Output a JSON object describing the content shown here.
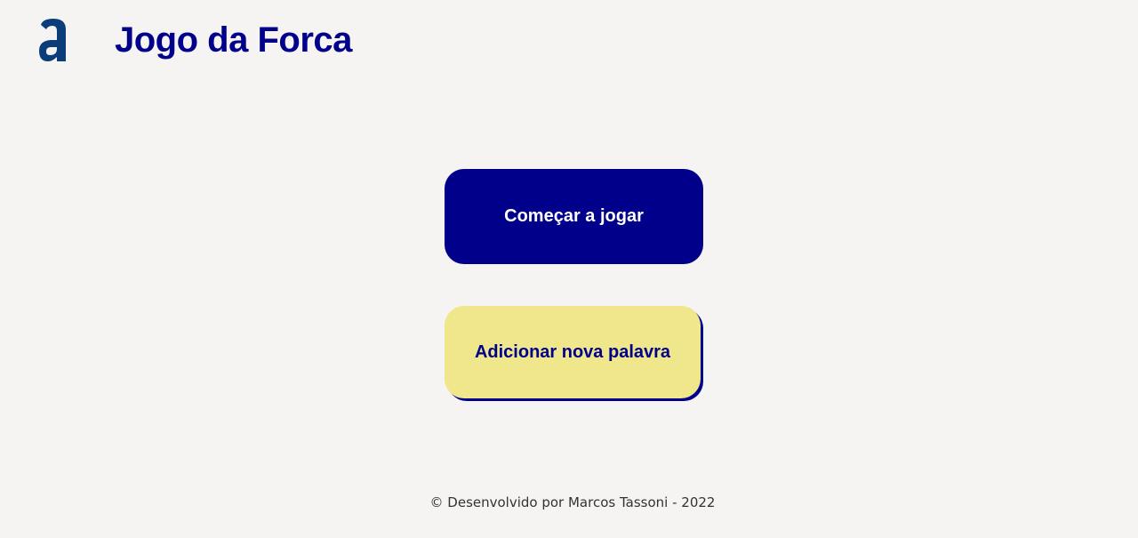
{
  "header": {
    "logo_icon": "alura-a-logo-icon",
    "logo_color": "#0b3d7a",
    "title": "Jogo da Forca"
  },
  "main": {
    "start_button_label": "Começar a jogar",
    "add_word_button_label": "Adicionar nova palavra"
  },
  "footer": {
    "text": "© Desenvolvido por Marcos Tassoni - 2022"
  },
  "colors": {
    "background": "#f5f4f3",
    "primary": "#00008b",
    "secondary": "#f0e68c",
    "text_light": "#ffffff",
    "footer_text": "#333333"
  }
}
